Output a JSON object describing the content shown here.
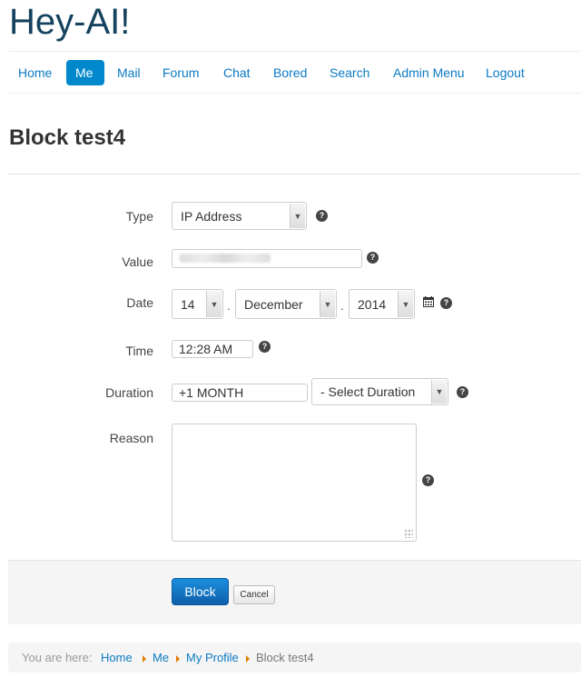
{
  "site": {
    "title": "Hey-AI!"
  },
  "nav": [
    {
      "label": "Home"
    },
    {
      "label": "Me",
      "active": true
    },
    {
      "label": "Mail"
    },
    {
      "label": "Forum"
    },
    {
      "label": "Chat"
    },
    {
      "label": "Bored"
    },
    {
      "label": "Search"
    },
    {
      "label": "Admin Menu"
    },
    {
      "label": "Logout"
    }
  ],
  "page": {
    "title": "Block test4"
  },
  "form": {
    "type": {
      "label": "Type",
      "value": "IP Address"
    },
    "value": {
      "label": "Value",
      "value": ""
    },
    "date": {
      "label": "Date",
      "day": "14",
      "month": "December",
      "year": "2014",
      "separator": "."
    },
    "time": {
      "label": "Time",
      "value": "12:28 AM"
    },
    "duration": {
      "label": "Duration",
      "value": "+1 MONTH",
      "select": "- Select Duration"
    },
    "reason": {
      "label": "Reason",
      "value": ""
    },
    "help_glyph": "?"
  },
  "actions": {
    "block": "Block",
    "cancel": "Cancel"
  },
  "breadcrumb": {
    "prefix": "You are here:",
    "items": [
      "Home",
      "Me",
      "My Profile"
    ],
    "current": "Block test4"
  },
  "colors": {
    "accent": "#0088cc",
    "link": "#0b7ac3",
    "brand": "#15425e",
    "crumb_arrow": "#e07b00"
  }
}
